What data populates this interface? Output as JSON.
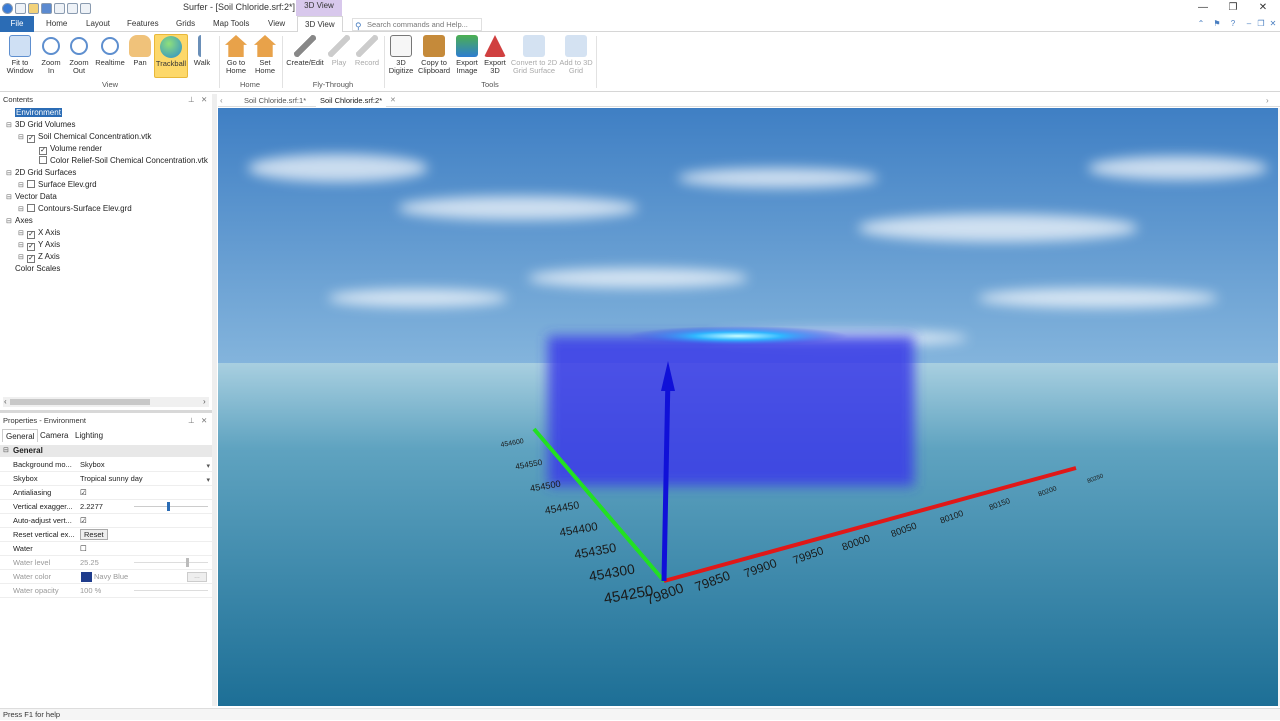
{
  "titlebar": {
    "title": "Surfer - [Soil Chloride.srf:2*]",
    "context_tab": "3D View",
    "controls": [
      "—",
      "❐",
      "✕"
    ]
  },
  "ribbon_tabs": [
    "File",
    "Home",
    "Layout",
    "Features",
    "Grids",
    "Map Tools",
    "View",
    "3D View"
  ],
  "search": {
    "placeholder": "Search commands and Help..."
  },
  "ribbon": {
    "view_group": {
      "label": "View",
      "buttons": [
        "Fit to Window",
        "Zoom In",
        "Zoom Out",
        "Realtime",
        "Pan",
        "Trackball",
        "Walk"
      ]
    },
    "home_group": {
      "label": "Home",
      "buttons": [
        "Go to Home",
        "Set Home"
      ]
    },
    "flythrough_group": {
      "label": "Fly-Through",
      "buttons": [
        "Create/Edit",
        "Play",
        "Record"
      ]
    },
    "tools_group": {
      "label": "Tools",
      "buttons": [
        "3D Digitize",
        "Copy to Clipboard",
        "Export Image",
        "Export 3D",
        "Convert to 2D Grid Surface",
        "Add to 3D Grid"
      ]
    }
  },
  "contents": {
    "header": "Contents",
    "items": [
      {
        "label": "Environment",
        "checked": null,
        "level": 0,
        "selected": true
      },
      {
        "label": "3D Grid Volumes",
        "checked": null,
        "level": 0
      },
      {
        "label": "Soil Chemical Concentration.vtk",
        "checked": true,
        "level": 1
      },
      {
        "label": "Volume render",
        "checked": true,
        "level": 2
      },
      {
        "label": "Color Relief-Soil Chemical Concentration.vtk",
        "checked": false,
        "level": 2
      },
      {
        "label": "2D Grid Surfaces",
        "checked": null,
        "level": 0
      },
      {
        "label": "Surface Elev.grd",
        "checked": false,
        "level": 1
      },
      {
        "label": "Vector Data",
        "checked": null,
        "level": 0
      },
      {
        "label": "Contours-Surface Elev.grd",
        "checked": false,
        "level": 1
      },
      {
        "label": "Axes",
        "checked": null,
        "level": 0
      },
      {
        "label": "X Axis",
        "checked": true,
        "level": 1
      },
      {
        "label": "Y Axis",
        "checked": true,
        "level": 1
      },
      {
        "label": "Z Axis",
        "checked": true,
        "level": 1
      },
      {
        "label": "Color Scales",
        "checked": null,
        "level": 0
      }
    ]
  },
  "properties": {
    "header": "Properties - Environment",
    "tabs": [
      "General",
      "Camera",
      "Lighting"
    ],
    "group": "General",
    "rows": [
      {
        "name": "Background mo...",
        "value": "Skybox"
      },
      {
        "name": "Skybox",
        "value": "Tropical sunny day"
      },
      {
        "name": "Antialiasing",
        "value": "☑"
      },
      {
        "name": "Vertical exagger...",
        "value": "2.2277"
      },
      {
        "name": "Auto-adjust vert...",
        "value": "☑"
      },
      {
        "name": "Reset vertical ex...",
        "value": "Reset"
      },
      {
        "name": "Water",
        "value": "☐"
      },
      {
        "name": "Water level",
        "value": "25.25"
      },
      {
        "name": "Water color",
        "value": "Navy Blue"
      },
      {
        "name": "Water opacity",
        "value": "100 %"
      }
    ],
    "vertical_exaggeration_slider_level": 0.45,
    "water_level_slider_level": 0.7
  },
  "doc_tabs": [
    "Soil Chloride.srf:1*",
    "Soil Chloride.srf:2*"
  ],
  "axes": {
    "y_ticks": [
      "454250",
      "454300",
      "454350",
      "454400",
      "454450",
      "454500",
      "454550",
      "454600"
    ],
    "x_ticks": [
      "79800",
      "79850",
      "79900",
      "79950",
      "80000",
      "80050",
      "80100",
      "80150",
      "80200",
      "80250"
    ]
  },
  "status": "Press F1 for help",
  "colors": {
    "file_tab": "#2b6cb5",
    "context_tab": "#d8c8ec",
    "selected_tool": "#fdd86a",
    "x_axis": "#e01818",
    "y_axis": "#22e022",
    "z_axis": "#1010d8",
    "volume": "#3b3be8"
  }
}
